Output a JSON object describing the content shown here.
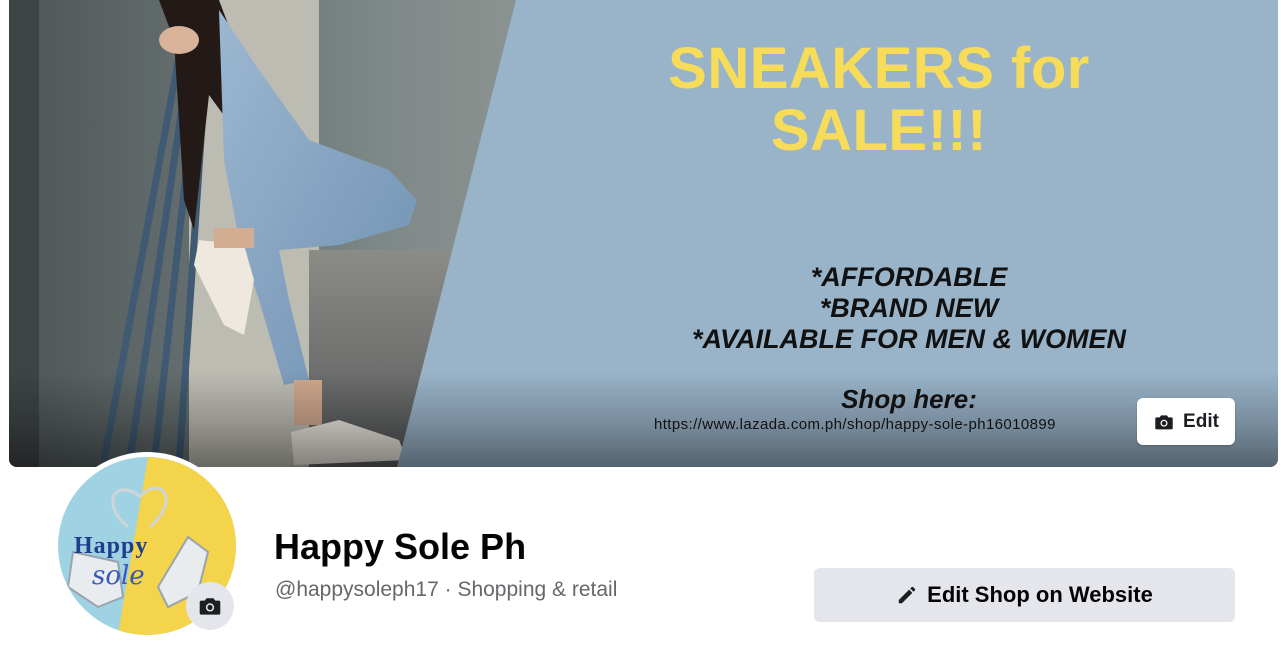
{
  "cover": {
    "headline_line1": "SNEAKERS for",
    "headline_line2": "SALE!!!",
    "features": [
      "*AFFORDABLE",
      "*BRAND NEW",
      "*AVAILABLE FOR MEN & WOMEN"
    ],
    "shop_here": "Shop here:",
    "shop_url": "https://www.lazada.com.ph/shop/happy-sole-ph16010899",
    "edit_label": "Edit"
  },
  "avatar": {
    "text_line1": "Happy",
    "text_line2": "sole"
  },
  "page": {
    "name": "Happy Sole Ph",
    "subtitle": "@happysoleph17 · Shopping & retail"
  },
  "actions": {
    "edit_shop_label": "Edit Shop on Website"
  },
  "colors": {
    "cover_blue": "#99b3c8",
    "headline_yellow": "#f7dc5a",
    "button_gray": "#e4e6eb",
    "avatar_blue": "#9fd3e3",
    "avatar_yellow": "#f3d44a"
  },
  "icons": {
    "cover_edit": "camera-icon",
    "avatar_edit": "camera-icon",
    "edit_shop": "pencil-icon"
  }
}
